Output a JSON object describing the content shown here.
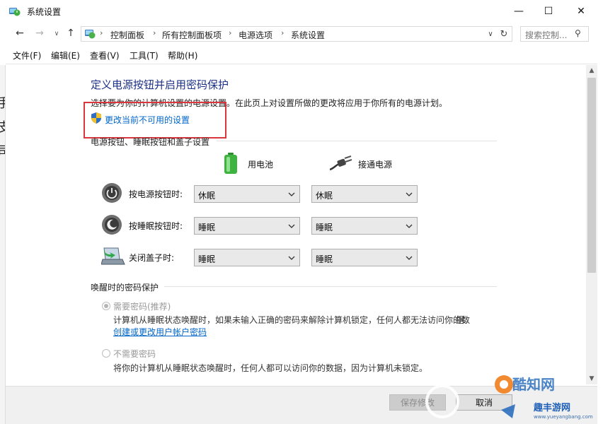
{
  "window": {
    "title": "系统设置",
    "minimize_glyph": "—",
    "maximize_glyph": "☐",
    "close_glyph": "✕"
  },
  "nav": {
    "back_glyph": "←",
    "forward_glyph": "→",
    "dropdown_glyph": "∨",
    "up_glyph": "↑",
    "breadcrumbs": [
      "控制面板",
      "所有控制面板项",
      "电源选项",
      "系统设置"
    ],
    "separator": "›",
    "address_drop_glyph": "∨",
    "refresh_glyph": "↻",
    "search_placeholder": "搜索控制...",
    "search_glyph": "⚲"
  },
  "menu": [
    "文件(F)",
    "编辑(E)",
    "查看(V)",
    "工具(T)",
    "帮助(H)"
  ],
  "content": {
    "heading": "定义电源按钮并启用密码保护",
    "description": "选择要为你的计算机设置的电源设置。在此页上对设置所做的更改将应用于你所有的电源计划。",
    "change_link": "更改当前不可用的设置",
    "section1_title": "电源按钮、睡眠按钮和盖子设置",
    "battery_label": "用电池",
    "plugged_label": "接通电源",
    "rows": [
      {
        "label": "按电源按钮时:",
        "battery": "休眠",
        "plugged": "休眠"
      },
      {
        "label": "按睡眠按钮时:",
        "battery": "睡眠",
        "plugged": "睡眠"
      },
      {
        "label": "关闭盖子时:",
        "battery": "睡眠",
        "plugged": "睡眠"
      }
    ],
    "section2_title": "唤醒时的密码保护",
    "opt1_label": "需要密码(推荐)",
    "opt1_desc": "计算机从睡眠状态唤醒时，如果未输入正确的密码来解除计算机锁定，任何人都无法访问你的数",
    "opt1_desc2": "据。",
    "opt1_link": "创建或更改用户帐户密码",
    "opt2_label": "不需要密码",
    "opt2_desc": "将你的计算机从睡眠状态唤醒时，任何人都可以访问你的数据，因为计算机未锁定。"
  },
  "scroll": {
    "up_glyph": "▲",
    "down_glyph": "▼"
  },
  "footer": {
    "save": "保存修改",
    "cancel": "取消"
  },
  "watermark": {
    "brand": "酷知网",
    "brand2": "趣丰游网",
    "url": "www.yueyangbang.com"
  },
  "left_strip_glyphs": [
    "手",
    "皮",
    "司"
  ],
  "colors": {
    "heading": "#1e3287",
    "link": "#0066cc",
    "highlight_box": "#d9363e"
  }
}
